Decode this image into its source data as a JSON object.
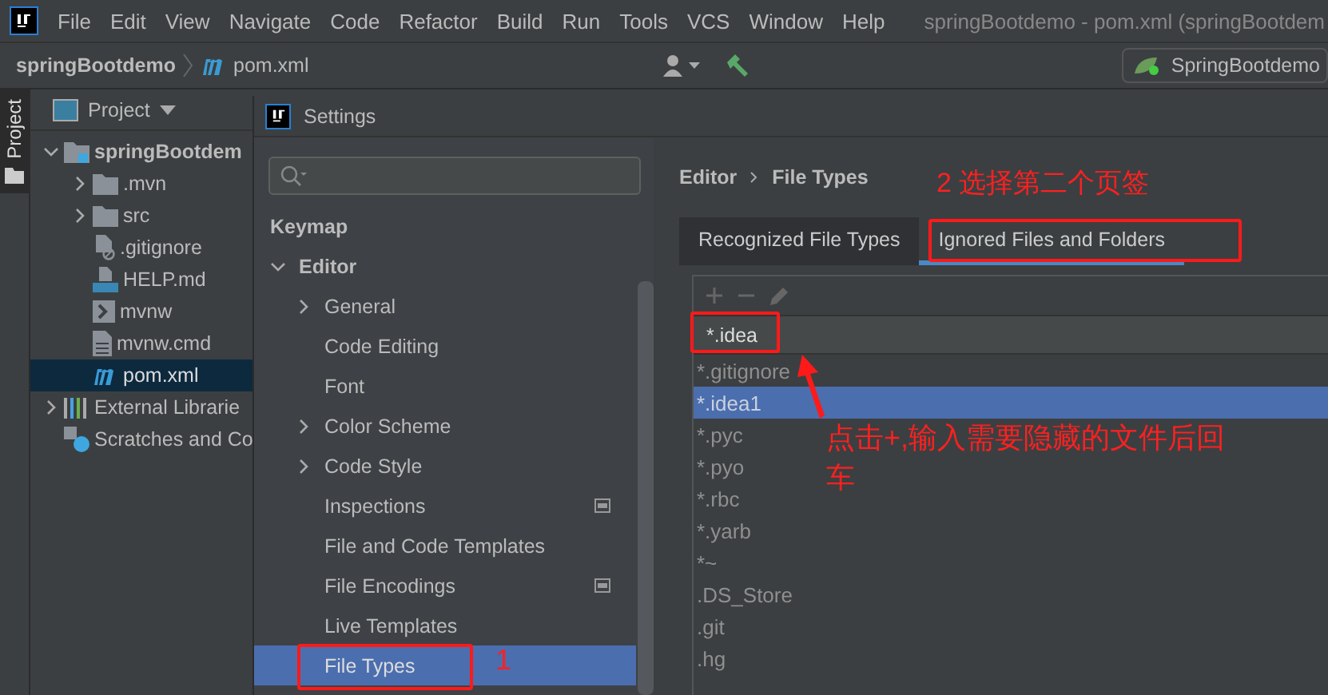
{
  "menu_bar": {
    "items": [
      "File",
      "Edit",
      "View",
      "Navigate",
      "Code",
      "Refactor",
      "Build",
      "Run",
      "Tools",
      "VCS",
      "Window",
      "Help"
    ],
    "title": "springBootdemo - pom.xml (springBootdem"
  },
  "nav_bar": {
    "crumbs": [
      "springBootdemo",
      "pom.xml"
    ],
    "run_config": "SpringBootdemo"
  },
  "tool_strip": {
    "label": "Project"
  },
  "project_panel": {
    "title": "Project",
    "tree": [
      {
        "label": "springBootdem",
        "kind": "module",
        "expanded": true,
        "selected": false,
        "children": [
          {
            "label": ".mvn",
            "kind": "folder",
            "expanded": false,
            "selected": false
          },
          {
            "label": "src",
            "kind": "folder",
            "expanded": false,
            "selected": false
          },
          {
            "label": ".gitignore",
            "kind": "ignore",
            "selected": false
          },
          {
            "label": "HELP.md",
            "kind": "markdown",
            "selected": false
          },
          {
            "label": "mvnw",
            "kind": "script",
            "selected": false
          },
          {
            "label": "mvnw.cmd",
            "kind": "text",
            "selected": false
          },
          {
            "label": "pom.xml",
            "kind": "maven",
            "selected": true
          }
        ]
      },
      {
        "label": "External Librarie",
        "kind": "libraries",
        "expanded": false,
        "selected": false
      },
      {
        "label": "Scratches and Co",
        "kind": "scratches",
        "selected": false
      }
    ]
  },
  "settings": {
    "title": "Settings",
    "items": [
      {
        "label": "Keymap",
        "kind": "top",
        "selected": false
      },
      {
        "label": "Editor",
        "kind": "top",
        "expanded": true,
        "selected": false
      },
      {
        "label": "General",
        "kind": "child",
        "expanded": false,
        "selected": false
      },
      {
        "label": "Code Editing",
        "kind": "child",
        "selected": false
      },
      {
        "label": "Font",
        "kind": "child",
        "selected": false
      },
      {
        "label": "Color Scheme",
        "kind": "child",
        "expanded": false,
        "selected": false
      },
      {
        "label": "Code Style",
        "kind": "child",
        "expanded": false,
        "selected": false
      },
      {
        "label": "Inspections",
        "kind": "child",
        "has_scope_icon": true,
        "selected": false
      },
      {
        "label": "File and Code Templates",
        "kind": "child",
        "selected": false
      },
      {
        "label": "File Encodings",
        "kind": "child",
        "has_scope_icon": true,
        "selected": false
      },
      {
        "label": "Live Templates",
        "kind": "child",
        "selected": false
      },
      {
        "label": "File Types",
        "kind": "child",
        "selected": true
      }
    ],
    "breadcrumb": [
      "Editor",
      "File Types"
    ],
    "tabs": [
      {
        "label": "Recognized File Types",
        "selected": false
      },
      {
        "label": "Ignored Files and Folders",
        "selected": true
      }
    ],
    "editing_value": "*.idea",
    "patterns": [
      {
        "label": "*.gitignore",
        "selected": false
      },
      {
        "label": "*.idea1",
        "selected": true
      },
      {
        "label": "*.pyc",
        "selected": false
      },
      {
        "label": "*.pyo",
        "selected": false
      },
      {
        "label": "*.rbc",
        "selected": false
      },
      {
        "label": "*.yarb",
        "selected": false
      },
      {
        "label": "*~",
        "selected": false
      },
      {
        "label": ".DS_Store",
        "selected": false
      },
      {
        "label": ".git",
        "selected": false
      },
      {
        "label": ".hg",
        "selected": false
      }
    ]
  },
  "annotations": [
    {
      "kind": "box"
    },
    {
      "kind": "label",
      "text": "1"
    },
    {
      "kind": "label",
      "text": "2 选择第二个页签"
    },
    {
      "kind": "box"
    },
    {
      "kind": "box"
    },
    {
      "kind": "arrow"
    },
    {
      "kind": "note",
      "text": "点击+,输入需要隐藏的文件后回车"
    }
  ]
}
